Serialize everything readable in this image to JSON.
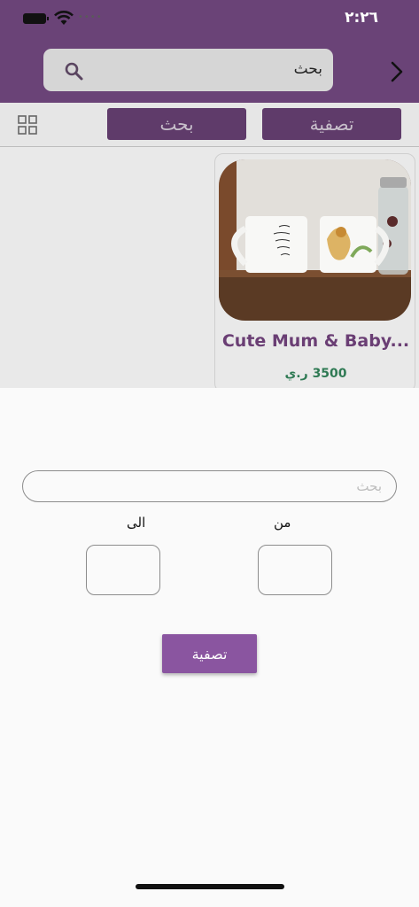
{
  "status_bar": {
    "time": "٢:٢٦",
    "signal_dots": "••••"
  },
  "header": {
    "search_text": "بحث"
  },
  "toolbar": {
    "search_label": "بحث",
    "filter_label": "تصفية"
  },
  "product": {
    "name": "Cute Mum & Baby...",
    "price": "3500 ر.ي"
  },
  "filter_sheet": {
    "search_placeholder": "بحث",
    "to_label": "الى",
    "from_label": "من",
    "to_value": "",
    "from_value": "",
    "apply_label": "تصفية"
  },
  "colors": {
    "brand": "#6a4377",
    "button": "#8a55a0",
    "price": "#2f7a54"
  }
}
